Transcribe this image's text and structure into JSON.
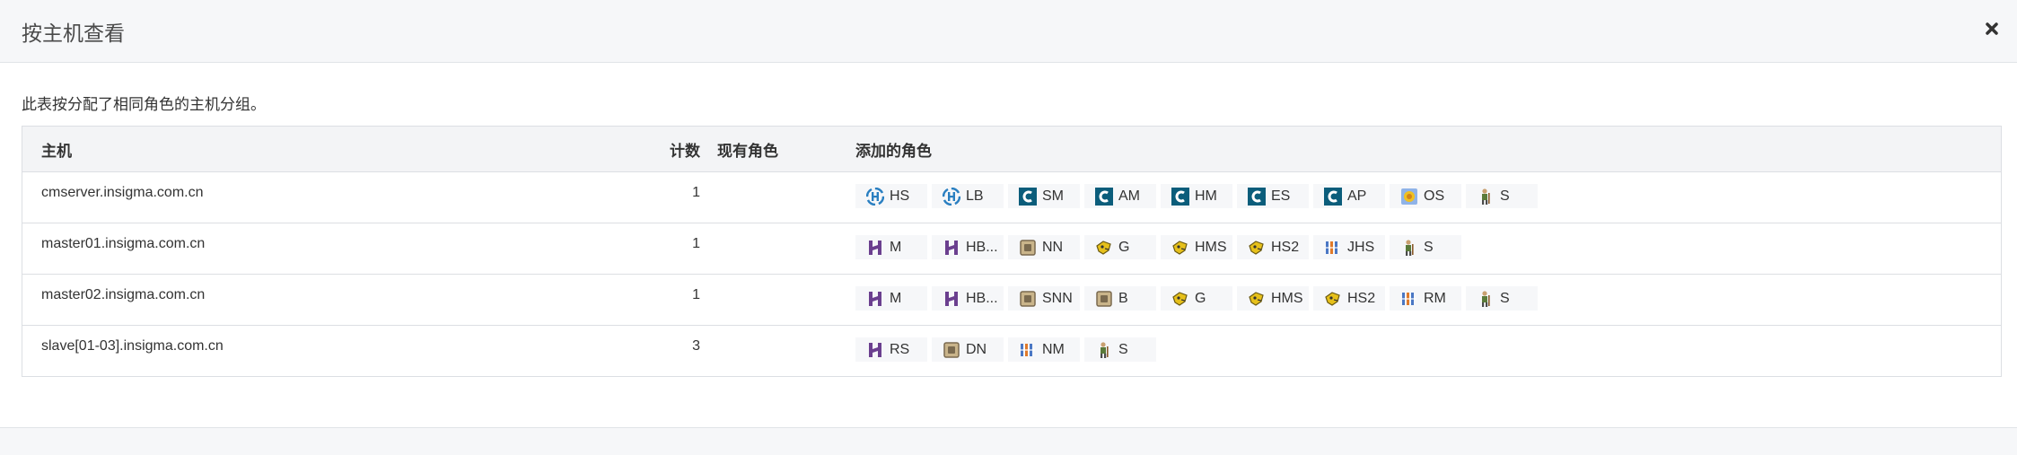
{
  "dialog": {
    "title": "按主机查看",
    "description": "此表按分配了相同角色的主机分组。"
  },
  "table": {
    "headers": {
      "host": "主机",
      "count": "计数",
      "existing_roles": "现有角色",
      "added_roles": "添加的角色"
    },
    "rows": [
      {
        "host": "cmserver.insigma.com.cn",
        "count": "1",
        "roles": [
          {
            "icon": "hue",
            "label": "HS"
          },
          {
            "icon": "hue",
            "label": "LB"
          },
          {
            "icon": "cloudera",
            "label": "SM"
          },
          {
            "icon": "cloudera",
            "label": "AM"
          },
          {
            "icon": "cloudera",
            "label": "HM"
          },
          {
            "icon": "cloudera",
            "label": "ES"
          },
          {
            "icon": "cloudera",
            "label": "AP"
          },
          {
            "icon": "oozie",
            "label": "OS"
          },
          {
            "icon": "zookeeper",
            "label": "S"
          }
        ]
      },
      {
        "host": "master01.insigma.com.cn",
        "count": "1",
        "roles": [
          {
            "icon": "hbase",
            "label": "M"
          },
          {
            "icon": "hbase",
            "label": "HB..."
          },
          {
            "icon": "hdfs",
            "label": "NN"
          },
          {
            "icon": "hive",
            "label": "G"
          },
          {
            "icon": "hive",
            "label": "HMS"
          },
          {
            "icon": "hive",
            "label": "HS2"
          },
          {
            "icon": "yarn",
            "label": "JHS"
          },
          {
            "icon": "zookeeper",
            "label": "S"
          }
        ]
      },
      {
        "host": "master02.insigma.com.cn",
        "count": "1",
        "roles": [
          {
            "icon": "hbase",
            "label": "M"
          },
          {
            "icon": "hbase",
            "label": "HB..."
          },
          {
            "icon": "hdfs",
            "label": "SNN"
          },
          {
            "icon": "hdfs",
            "label": "B"
          },
          {
            "icon": "hive",
            "label": "G"
          },
          {
            "icon": "hive",
            "label": "HMS"
          },
          {
            "icon": "hive",
            "label": "HS2"
          },
          {
            "icon": "yarn",
            "label": "RM"
          },
          {
            "icon": "zookeeper",
            "label": "S"
          }
        ]
      },
      {
        "host": "slave[01-03].insigma.com.cn",
        "count": "3",
        "roles": [
          {
            "icon": "hbase",
            "label": "RS"
          },
          {
            "icon": "hdfs",
            "label": "DN"
          },
          {
            "icon": "yarn",
            "label": "NM"
          },
          {
            "icon": "zookeeper",
            "label": "S"
          }
        ]
      }
    ]
  },
  "colors": {
    "hue": "#2a7fc1",
    "cloudera": "#0b5d7b",
    "hbase": "#6b3f8f",
    "hdfs": "#7a6a4f",
    "hive": "#e6c01a",
    "yarn": "#4a77c4",
    "oozie": "#f0c020",
    "zookeeper": "#5a7a3a"
  }
}
